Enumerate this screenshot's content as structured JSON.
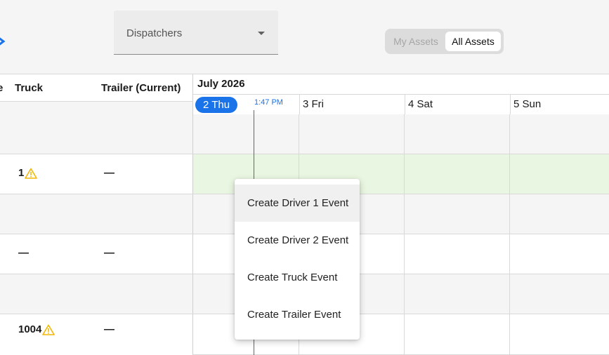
{
  "toolbar": {
    "dispatcher_select": {
      "value": "Dispatchers"
    },
    "asset_toggle": {
      "my_assets": "My Assets",
      "all_assets": "All Assets",
      "selected": "All Assets"
    }
  },
  "columns": {
    "partial": "e",
    "truck": "Truck",
    "trailer": "Trailer (Current)"
  },
  "calendar": {
    "month": "July 2026",
    "days": [
      "2 Thu",
      "3 Fri",
      "4 Sat",
      "5 Sun"
    ],
    "today": "2 Thu",
    "now_label": "1:47 PM"
  },
  "rows": [
    {
      "truck": "",
      "trailer": "",
      "shade": "grey"
    },
    {
      "truck": "1",
      "truck_warning": true,
      "trailer": "—",
      "shade": "green"
    },
    {
      "truck": "",
      "trailer": "",
      "shade": "grey"
    },
    {
      "truck": "—",
      "trailer": "—",
      "shade": "white"
    },
    {
      "truck": "",
      "trailer": "",
      "shade": "grey"
    },
    {
      "truck": "1004",
      "truck_warning": true,
      "trailer": "—",
      "shade": "white"
    }
  ],
  "context_menu": {
    "items": [
      "Create Driver 1 Event",
      "Create Driver 2 Event",
      "Create Truck Event",
      "Create Trailer Event"
    ],
    "highlighted": "Create Driver 1 Event"
  },
  "colors": {
    "accent": "#1a73e8",
    "warning": "#f2b705",
    "highlight_row": "#e9f6e1"
  },
  "icons": {
    "nav": "chevron-right-icon",
    "warning": "warning-icon",
    "dropdown": "caret-down-icon"
  }
}
